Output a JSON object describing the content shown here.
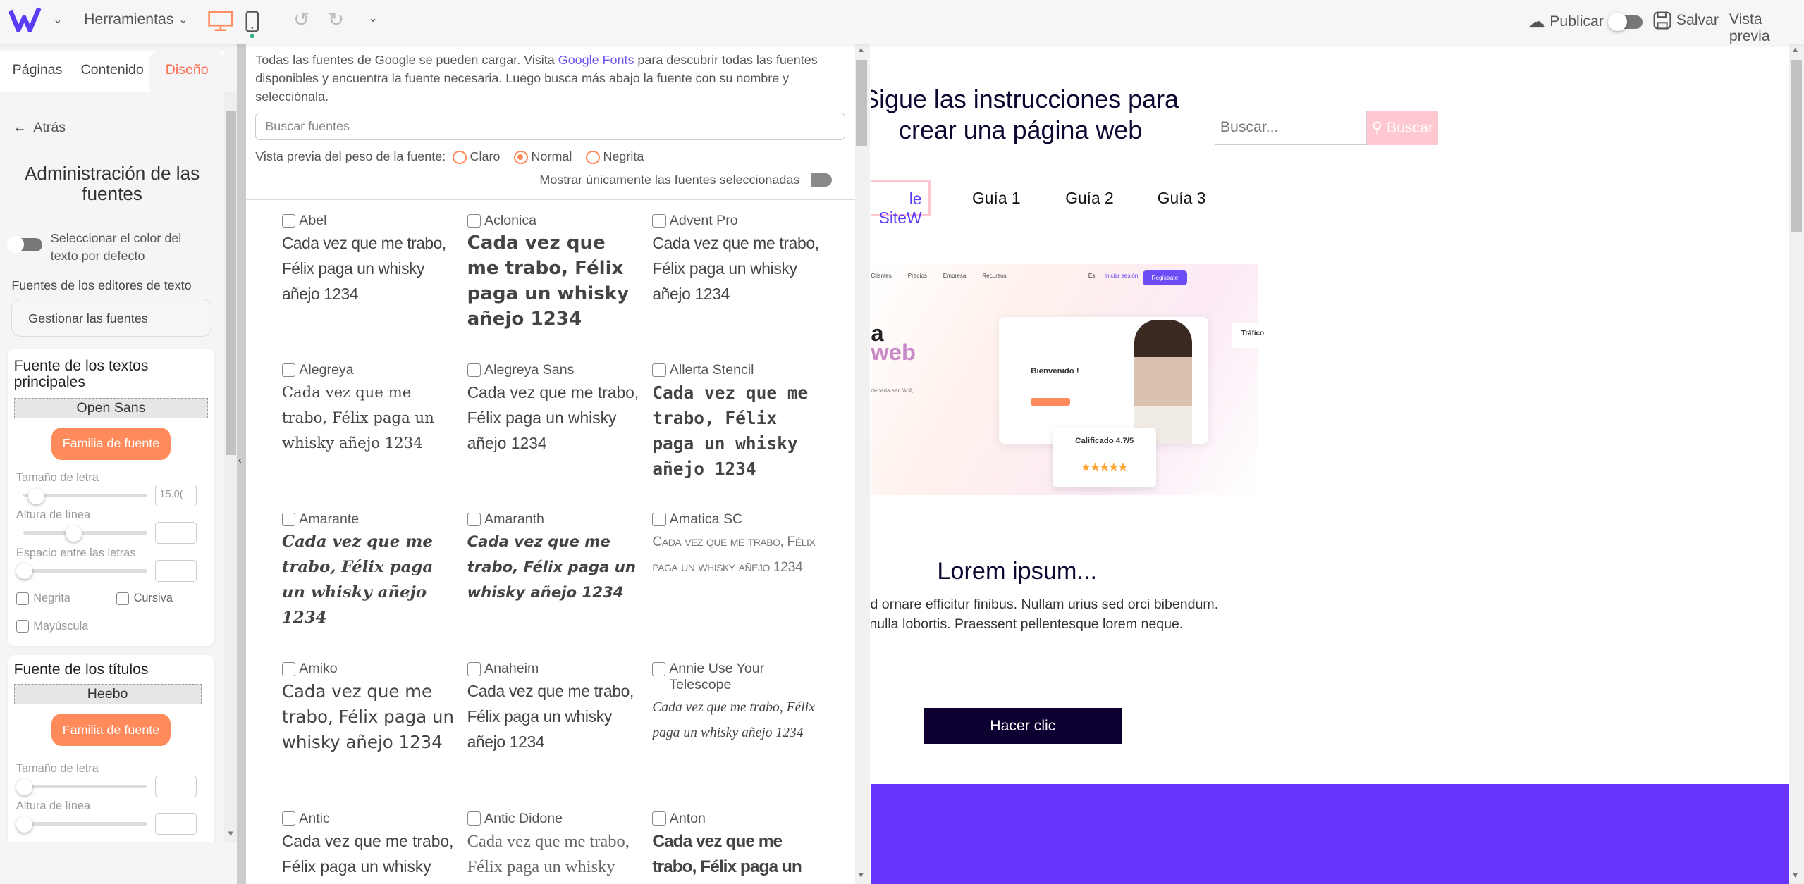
{
  "topbar": {
    "logo": "W",
    "tools_label": "Herramientas",
    "publish_label": "Publicar",
    "save_label": "Salvar",
    "preview_label": "Vista previa",
    "accent": "#ff8a5b",
    "brand": "#5b3cf5"
  },
  "sidebar": {
    "tabs": [
      {
        "label": "Páginas"
      },
      {
        "label": "Contenido"
      },
      {
        "label": "Diseño",
        "active": true
      }
    ],
    "back_label": "Atrás",
    "title": "Administración de las fuentes",
    "default_color_toggle": "Seleccionar el color del texto por defecto",
    "editor_fonts_label": "Fuentes de los editores de texto",
    "manage_fonts_button": "Gestionar las fuentes",
    "main_text": {
      "heading": "Fuente de los textos principales",
      "font": "Open Sans",
      "family_button": "Familia de fuente",
      "size_label": "Tamaño de letra",
      "size_value": "15.0(",
      "size_slider": 0.1,
      "line_height_label": "Altura de línea",
      "line_height_slider": 0.4,
      "letter_spacing_label": "Espacio entre las letras",
      "letter_spacing_slider": 0,
      "bold_label": "Negrita",
      "italic_label": "Cursiva",
      "uppercase_label": "Mayúscula"
    },
    "titles": {
      "heading": "Fuente de los títulos",
      "font": "Heebo",
      "family_button": "Familia de fuente",
      "size_label": "Tamaño de letra",
      "line_height_label": "Altura de línea"
    }
  },
  "fonts_panel": {
    "desc_before": "Todas las fuentes de Google se pueden cargar. Visita ",
    "desc_link": "Google Fonts",
    "desc_after": " para descubrir todas las fuentes disponibles y encuentra la fuente necesaria. Luego busca más abajo la fuente con su nombre y selecciónala.",
    "search_placeholder": "Buscar fuentes",
    "weight_label": "Vista previa del peso de la fuente:",
    "weights": [
      {
        "label": "Claro"
      },
      {
        "label": "Normal",
        "selected": true
      },
      {
        "label": "Negrita"
      }
    ],
    "only_selected_label": "Mostrar únicamente las fuentes seleccionadas",
    "sample": "Cada vez que me trabo, Félix paga un whisky añejo 1234",
    "fonts": [
      {
        "name": "Abel"
      },
      {
        "name": "Aclonica"
      },
      {
        "name": "Advent Pro"
      },
      {
        "name": "Alegreya"
      },
      {
        "name": "Alegreya Sans"
      },
      {
        "name": "Allerta Stencil"
      },
      {
        "name": "Amarante"
      },
      {
        "name": "Amaranth"
      },
      {
        "name": "Amatica SC"
      },
      {
        "name": "Amiko"
      },
      {
        "name": "Anaheim"
      },
      {
        "name": "Annie Use Your Telescope"
      },
      {
        "name": "Antic"
      },
      {
        "name": "Antic Didone"
      },
      {
        "name": "Anton"
      }
    ]
  },
  "preview": {
    "title": "Sigue las instrucciones para crear una página web",
    "search_placeholder": "Buscar...",
    "search_button": "Buscar",
    "nav": [
      "le SiteW",
      "Guía 1",
      "Guía 2",
      "Guía 3"
    ],
    "hero": {
      "menu": [
        "Clientes",
        "Precios",
        "Empresa",
        "Recursos"
      ],
      "lang": "Es",
      "login": "Iniciar sesión",
      "register": "Regístrate",
      "headline_a": "a",
      "headline_b": "web",
      "tagline": "deberia ser fácil,",
      "welcome": "Bienvenido !",
      "rating": "Calificado 4.7/5",
      "traffic": "Tráfico"
    },
    "section_title": "Lorem ipsum...",
    "paragraph": "aretra interdum dictum. Sed ornare efficitur finibus. Nullam urius sed orci bibendum. Suspendise fringillia nulla lobortis. Praessent pellentesque lorem neque.",
    "cta": "Hacer clic",
    "band_color": "#6633ff"
  }
}
